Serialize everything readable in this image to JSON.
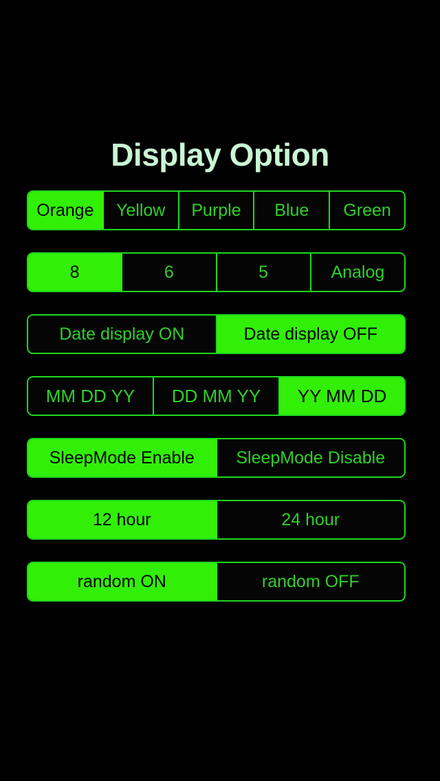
{
  "screen": {
    "background_color": "#000000",
    "accent_color": "#32ef08",
    "outline_color": "#1fd81f",
    "unselected_text_color": "#2fcf2a",
    "selected_text_color": "#000000",
    "title_color": "#c9f6d3"
  },
  "header": {
    "title": "Display Option"
  },
  "controls": [
    {
      "name": "color-theme",
      "segments": [
        {
          "label": "Orange",
          "selected": true
        },
        {
          "label": "Yellow",
          "selected": false
        },
        {
          "label": "Purple",
          "selected": false
        },
        {
          "label": "Blue",
          "selected": false
        },
        {
          "label": "Green",
          "selected": false
        }
      ]
    },
    {
      "name": "digit-count",
      "segments": [
        {
          "label": "8",
          "selected": true
        },
        {
          "label": "6",
          "selected": false
        },
        {
          "label": "5",
          "selected": false
        },
        {
          "label": "Analog",
          "selected": false
        }
      ]
    },
    {
      "name": "date-display",
      "segments": [
        {
          "label": "Date display ON",
          "selected": false
        },
        {
          "label": "Date display OFF",
          "selected": true
        }
      ]
    },
    {
      "name": "date-format",
      "segments": [
        {
          "label": "MM DD YY",
          "selected": false
        },
        {
          "label": "DD MM YY",
          "selected": false
        },
        {
          "label": "YY MM DD",
          "selected": true
        }
      ]
    },
    {
      "name": "sleep-mode",
      "segments": [
        {
          "label": "SleepMode Enable",
          "selected": true
        },
        {
          "label": "SleepMode Disable",
          "selected": false
        }
      ]
    },
    {
      "name": "hour-format",
      "segments": [
        {
          "label": "12 hour",
          "selected": true
        },
        {
          "label": "24 hour",
          "selected": false
        }
      ]
    },
    {
      "name": "random-mode",
      "segments": [
        {
          "label": "random ON",
          "selected": true
        },
        {
          "label": "random OFF",
          "selected": false
        }
      ]
    }
  ]
}
